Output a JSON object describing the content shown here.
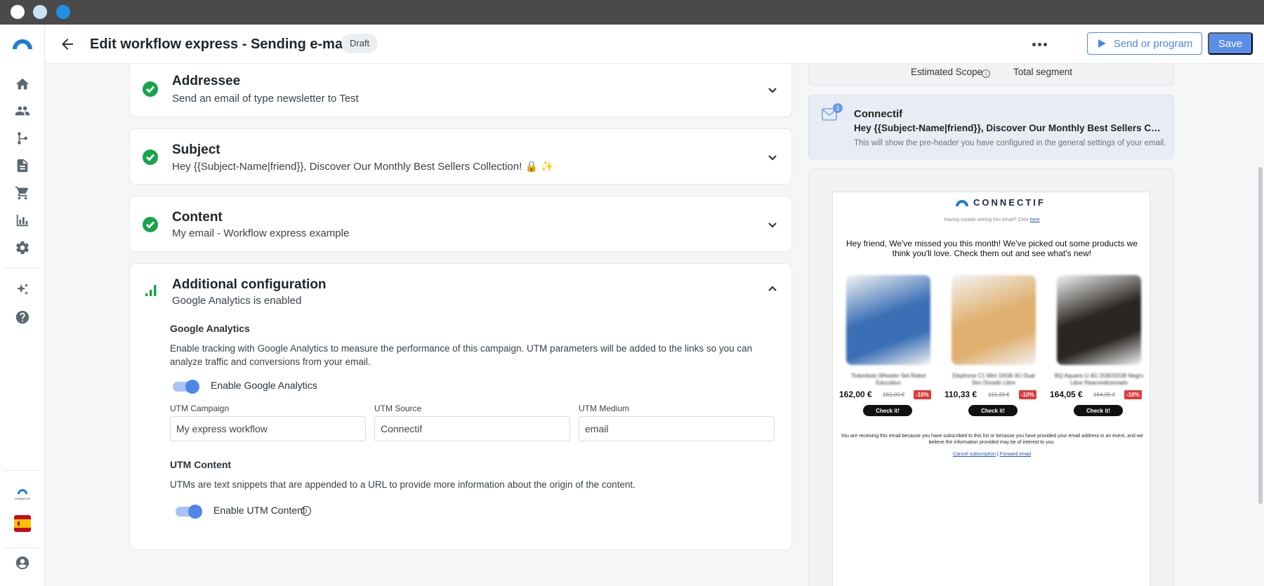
{
  "header": {
    "title": "Edit workflow express - Sending e-mails",
    "status_badge": "Draft",
    "send_label": "Send or program",
    "save_label": "Save"
  },
  "sidebar": {
    "items": [
      "home-icon",
      "contacts-icon",
      "workflows-icon",
      "content-icon",
      "cart-icon",
      "reports-icon",
      "settings-icon",
      "ai-sparkles-icon",
      "help-icon"
    ],
    "brand": "CONNECTIF",
    "account": "user-account-icon"
  },
  "steps": {
    "addressee": {
      "title": "Addressee",
      "summary": "Send an email of type newsletter to Test"
    },
    "subject": {
      "title": "Subject",
      "summary": "Hey {{Subject-Name|friend}}, Discover Our Monthly Best Sellers Collection! 🔒 ✨"
    },
    "content": {
      "title": "Content",
      "summary": "My email - Workflow express example"
    },
    "additional": {
      "title": "Additional configuration",
      "summary": "Google Analytics is enabled"
    }
  },
  "google_analytics": {
    "section_title": "Google Analytics",
    "description": "Enable tracking with Google Analytics to measure the performance of this campaign. UTM parameters will be added to the links so you can analyze traffic and conversions from your email.",
    "toggle_label": "Enable Google Analytics",
    "enabled": true,
    "utm_campaign_label": "UTM Campaign",
    "utm_campaign_value": "My express workflow",
    "utm_source_label": "UTM Source",
    "utm_source_value": "Connectif",
    "utm_medium_label": "UTM Medium",
    "utm_medium_value": "email"
  },
  "utm_content": {
    "section_title": "UTM Content",
    "description": "UTMs are text snippets that are appended to a URL to provide more information about the origin of the content.",
    "toggle_label": "Enable UTM Content",
    "enabled": true
  },
  "scope": {
    "estimated_label": "Estimated Scope",
    "total_label": "Total segment"
  },
  "inbox_preview": {
    "badge_count": "1",
    "sender": "Connectif",
    "subject": "Hey {{Subject-Name|friend}}, Discover Our Monthly Best Sellers Collection! 🔒 ✨",
    "preheader_note": "This will show the pre-header you have configured in the general settings of your email."
  },
  "email_preview": {
    "logo_text": "CONNECTIF",
    "trouble_text": "Having trouble seeing this email? Click ",
    "trouble_link": "here",
    "intro": "Hey friend, We've missed you this month! We've picked out some products we think you'll love. Check them out and see what's new!",
    "products": [
      {
        "name": "Tinkerbots Wheeler Set Robot Educativo",
        "price": "162,00 €",
        "old_price": "162,00 €",
        "discount": "-10%",
        "cta": "Check it!",
        "color": "#3a6fb5"
      },
      {
        "name": "Elephone C1 Mini 16GB 4G Dual Sim Dorado Libre",
        "price": "110,33 €",
        "old_price": "110,33 €",
        "discount": "-10%",
        "cta": "Check it!",
        "color": "#e0b070"
      },
      {
        "name": "BQ Aquaris U 4G 2GB/32GB Negro Libre Reacondicionado",
        "price": "164,05 €",
        "old_price": "164,05 €",
        "discount": "-10%",
        "cta": "Check it!",
        "color": "#2a2622"
      }
    ],
    "footer": "You are receiving this email because you have subscribed to this list or because you have provided your email address in an event, and we believe the information provided may be of interest to you.",
    "cancel_link": "Cancel subscription",
    "separator": " | ",
    "forward_link": "Forward email"
  },
  "colors": {
    "accent": "#4f86e8",
    "success": "#17a34a",
    "discount": "#e03a3a"
  }
}
